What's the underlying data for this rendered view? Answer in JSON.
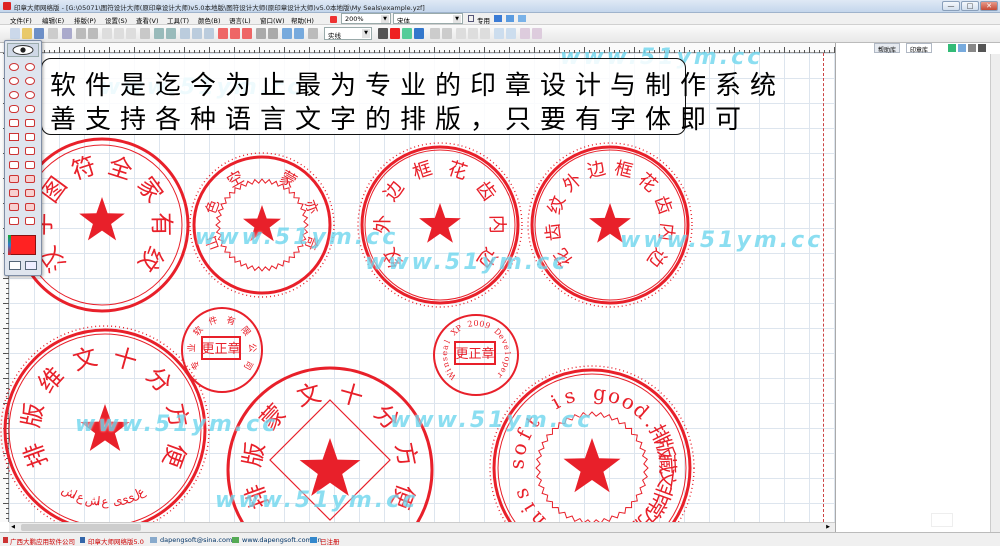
{
  "window": {
    "title": "印章大师网络版 - [G:\\05071\\图符设计大师(原印章设计大师)v5.0本地版\\图符设计大师(原印章设计大师)v5.0本地版\\My Seals\\example.yzf]",
    "min": "—",
    "max": "□",
    "close": "✕"
  },
  "menu": [
    "文件(F)",
    "编辑(E)",
    "排版(P)",
    "设置(S)",
    "查看(V)",
    "工具(T)",
    "颜色(B)",
    "语言(L)",
    "窗口(W)",
    "帮助(H)"
  ],
  "toolbar": {
    "zoom": "200%",
    "font": "宋体",
    "mode": "专用",
    "style": "实线"
  },
  "panel": {
    "tabs": [
      "帮助库",
      "印章库"
    ]
  },
  "banner": {
    "line1": "软件是迄今为止最为专业的印章设计与制作系统",
    "line2": "善支持各种语言文字的排版，只要有字体即可"
  },
  "watermark": "www.51ym.cc",
  "stamps": [
    {
      "id": "s1",
      "arc": "汉字图符全家有纹",
      "center": ""
    },
    {
      "id": "s2",
      "arc": "空蒙",
      "side": "亦奇",
      "left": "山色",
      "center": ""
    },
    {
      "id": "s3",
      "arc": "纹外边框花齿内边",
      "center": ""
    },
    {
      "id": "s4",
      "arc": "花齿纹外边框花齿内边",
      "center": ""
    },
    {
      "id": "s5",
      "arc": "专业软件有限公司",
      "center": "更正章"
    },
    {
      "id": "s6",
      "arc": "Winseal XP 2009 Developer",
      "center": "更正章"
    },
    {
      "id": "s7",
      "arc": "排版维文十分方便",
      "bottom": "علییی عاش عاش",
      "center": ""
    },
    {
      "id": "s8",
      "arc": "排版蒙文十分方便",
      "center": ""
    },
    {
      "id": "s9",
      "arc": "This soft is good.排版藏文非常方便",
      "center": ""
    }
  ],
  "status": {
    "company": "广西大鹏应用软件公司",
    "product": "印章大师网络版5.0",
    "email": "dapengsoft@sina.com",
    "website": "www.dapengsoft.com.cn",
    "register": "已注册"
  },
  "colors": {
    "stamp_red": "#e8202a",
    "watermark": "#6fd7ee",
    "grid": "#dde5ee"
  }
}
